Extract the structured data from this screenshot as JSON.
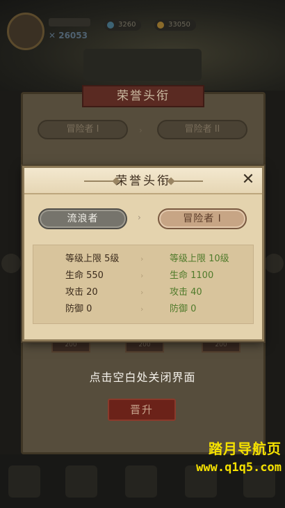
{
  "background": {
    "player_power": "✕ 26053",
    "resource_1": "3260",
    "resource_2": "33050",
    "panel_title": "荣誉头衔",
    "tag_left": "冒险者 I",
    "tag_right": "冒险者 II",
    "card_cost": "200",
    "promote_button": "晋升"
  },
  "dialog": {
    "title": "荣誉头衔",
    "close_symbol": "✕",
    "current_rank": "流浪者",
    "next_rank": "冒险者 I",
    "arrow": "›",
    "stats": [
      {
        "current": "等级上限 5级",
        "next": "等级上限 10级"
      },
      {
        "current": "生命 550",
        "next": "生命 1100"
      },
      {
        "current": "攻击 20",
        "next": "攻击 40"
      },
      {
        "current": "防御 0",
        "next": "防御 0"
      }
    ]
  },
  "hint": "点击空白处关闭界面",
  "watermark": {
    "title": "踏月导航页",
    "url": "www.q1q5.com"
  },
  "colors": {
    "upgrade_value": "#4f7a2a",
    "current_rank_bg": "#76746c",
    "next_rank_bg": "#c7a585",
    "watermark": "#f5e100"
  }
}
